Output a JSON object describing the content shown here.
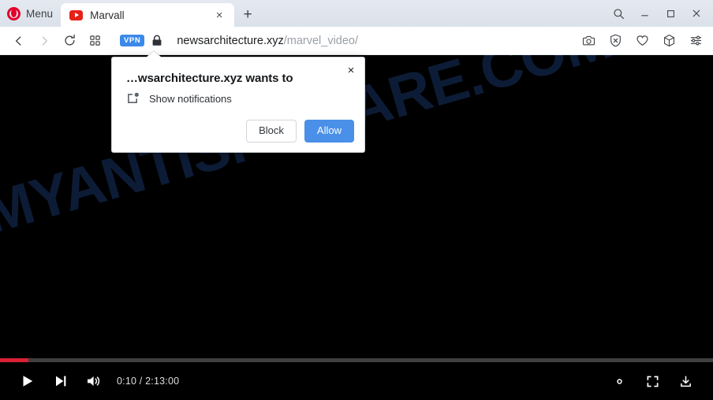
{
  "browser": {
    "menu_label": "Menu",
    "opera_logo_name": "opera-logo",
    "tabs": [
      {
        "title": "Marvall",
        "favicon": "youtube-play-icon",
        "close_glyph": "×"
      }
    ],
    "new_tab_glyph": "+",
    "window_controls": {
      "search_glyph": "search-icon",
      "minimize_glyph": "–",
      "maximize_glyph": "□",
      "close_glyph": "×"
    }
  },
  "toolbar": {
    "back_label": "Back",
    "forward_label": "Forward",
    "reload_label": "Reload",
    "tiles_label": "Tab islands",
    "vpn_badge": "VPN",
    "lock_label": "Secure connection",
    "url_host": "newsarchitecture.xyz",
    "url_path": "/marvel_video/",
    "right_icons": [
      {
        "name": "snapshot-icon",
        "label": "Snapshot"
      },
      {
        "name": "ad-blocker-icon",
        "label": "Ad blocker"
      },
      {
        "name": "heart-icon",
        "label": "Add to favorites"
      },
      {
        "name": "crypto-wallet-icon",
        "label": "Crypto wallet"
      },
      {
        "name": "easy-setup-icon",
        "label": "Easy setup"
      }
    ]
  },
  "page": {
    "watermark_text": "MYANTISPYWARE.COM",
    "watermark_color": "#0d1c36",
    "background_color": "#000000"
  },
  "player": {
    "progress_percent": 4,
    "progress_color": "#d92035",
    "track_color": "#3f3f3f",
    "current_time": "0:10",
    "duration": "2:13:00",
    "timecode": "0:10 / 2:13:00",
    "left_controls": [
      {
        "name": "play-button",
        "label": "Play"
      },
      {
        "name": "next-button",
        "label": "Next"
      },
      {
        "name": "volume-button",
        "label": "Volume"
      }
    ],
    "right_controls": [
      {
        "name": "settings-button",
        "label": "Settings"
      },
      {
        "name": "fullscreen-button",
        "label": "Fullscreen"
      },
      {
        "name": "download-button",
        "label": "Download"
      }
    ]
  },
  "dialog": {
    "title": "…wsarchitecture.xyz wants to",
    "permission_label": "Show notifications",
    "permission_icon": "notification-icon",
    "close_glyph": "×",
    "block_label": "Block",
    "allow_label": "Allow",
    "allow_color": "#4a90e8"
  }
}
